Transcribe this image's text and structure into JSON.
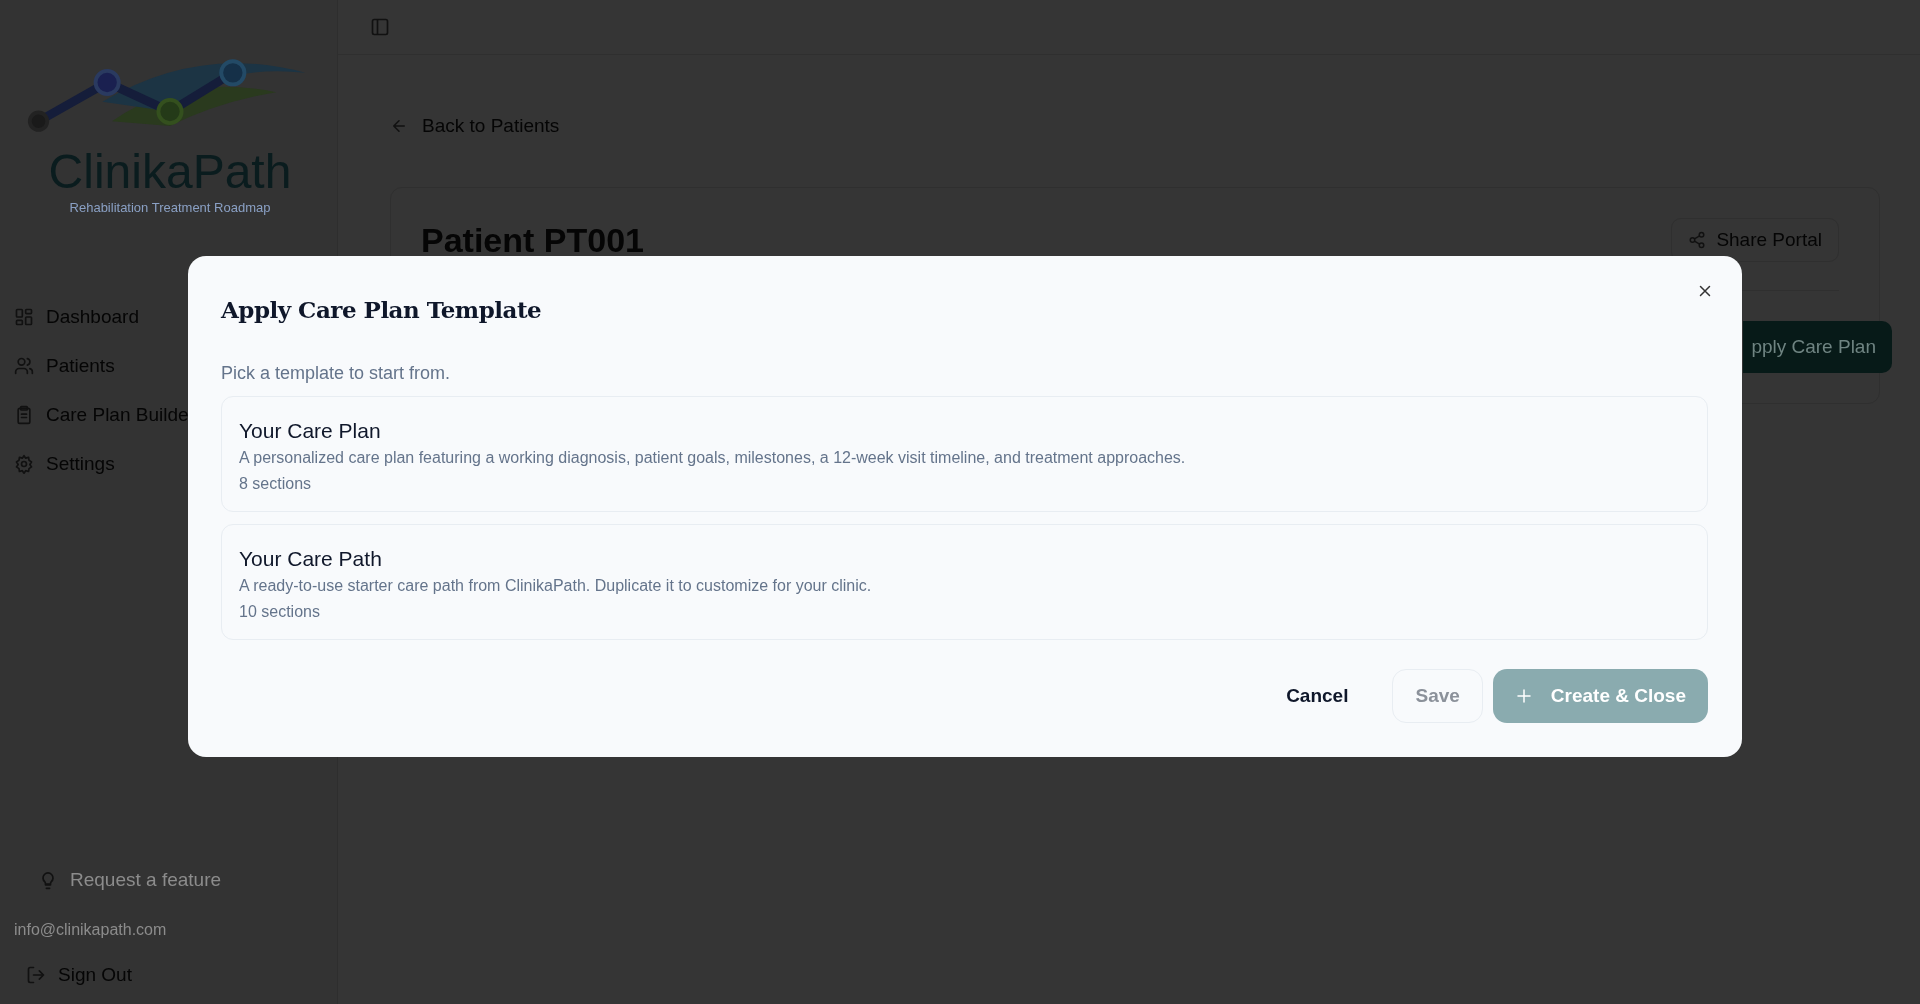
{
  "sidebar": {
    "logo": {
      "name": "ClinikaPath",
      "tagline": "Rehabilitation Treatment Roadmap"
    },
    "nav": [
      {
        "label": "Dashboard"
      },
      {
        "label": "Patients"
      },
      {
        "label": "Care Plan Builde"
      },
      {
        "label": "Settings"
      }
    ],
    "request_feature": "Request a feature",
    "email": "info@clinikapath.com",
    "sign_out": "Sign Out"
  },
  "back_link": "Back to Patients",
  "patient": {
    "title": "Patient PT001",
    "share_button": "Share Portal",
    "apply_button": "pply Care Plan"
  },
  "dialog": {
    "title": "Apply Care Plan Template",
    "subtitle": "Pick a template to start from.",
    "templates": [
      {
        "name": "Your Care Plan",
        "description": "A personalized care plan featuring a working diagnosis, patient goals, milestones, a 12-week visit timeline, and treatment approaches.",
        "sections": "8 sections"
      },
      {
        "name": "Your Care Path",
        "description": "A ready-to-use starter care path from ClinikaPath. Duplicate it to customize for your clinic.",
        "sections": "10 sections"
      }
    ],
    "buttons": [
      {
        "label": "Cancel",
        "kind": "ghost",
        "disabled": false
      },
      {
        "label": "Save",
        "kind": "outline",
        "disabled": true
      },
      {
        "label": "Create & Close",
        "kind": "primary",
        "disabled": true
      }
    ]
  }
}
